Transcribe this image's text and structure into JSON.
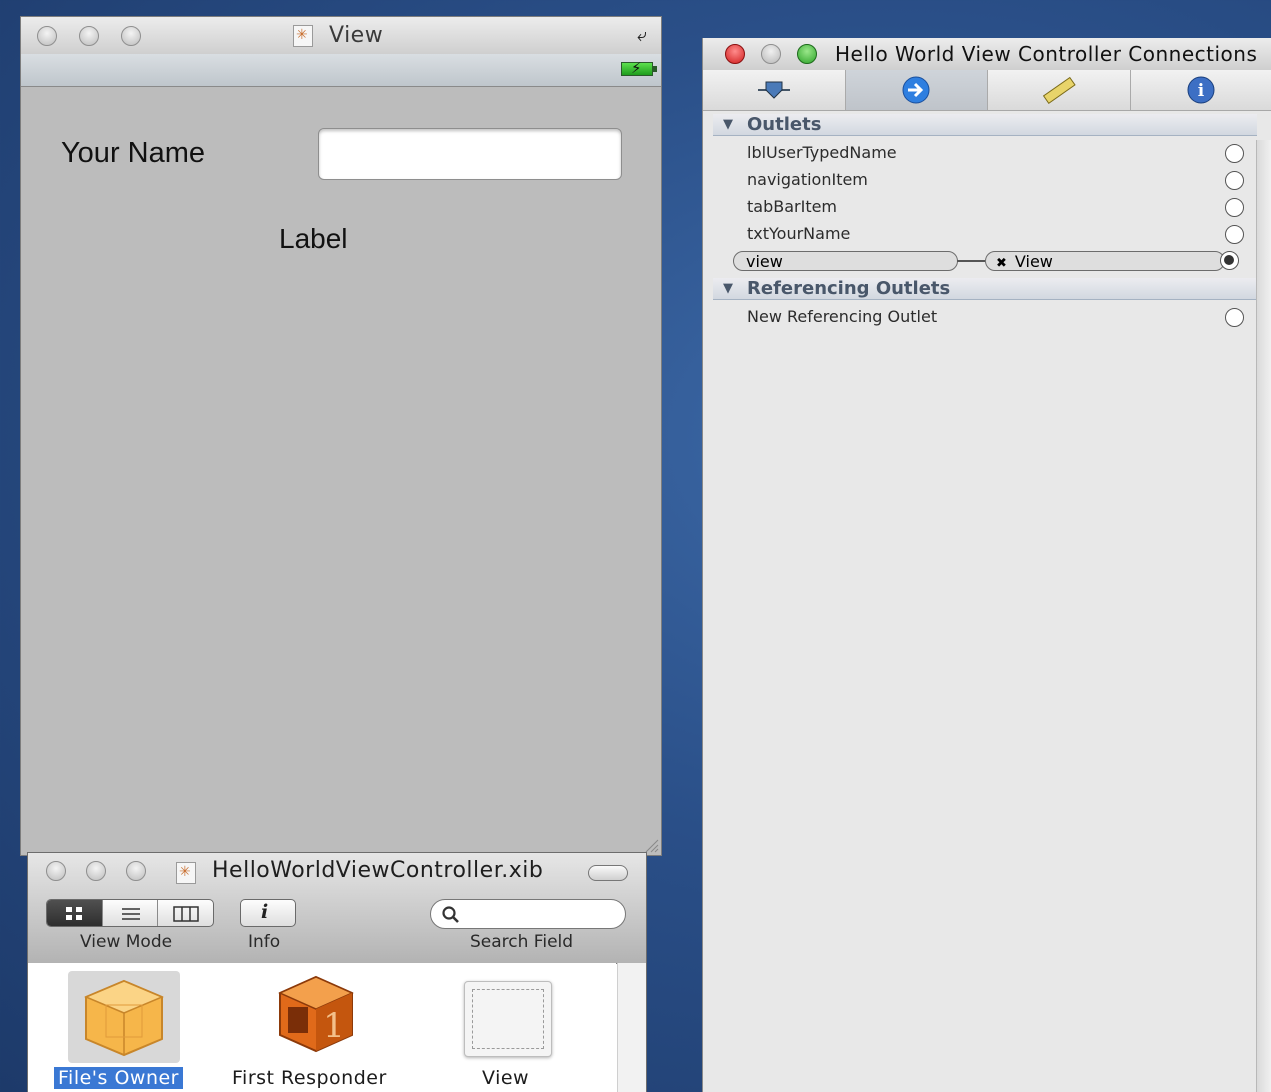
{
  "view_window": {
    "title": "View",
    "name_label": "Your  Name",
    "name_field_value": "",
    "label_text": "Label"
  },
  "connections": {
    "title": "Hello World View Controller Connections",
    "tabs": [
      "attributes-tab",
      "connections-tab",
      "size-tab",
      "identity-tab"
    ],
    "outlets_header": "Outlets",
    "outlets": [
      "lblUserTypedName",
      "navigationItem",
      "tabBarItem",
      "txtYourName"
    ],
    "connected_outlet": {
      "name": "view",
      "target": "View"
    },
    "referencing_header": "Referencing Outlets",
    "referencing": [
      "New Referencing Outlet"
    ]
  },
  "xib_window": {
    "title": "HelloWorldViewController.xib",
    "toolbar": {
      "view_mode_label": "View Mode",
      "info_label": "Info",
      "search_label": "Search Field",
      "search_value": ""
    },
    "objects": [
      {
        "label": "File's Owner",
        "selected": true
      },
      {
        "label": "First Responder",
        "selected": false
      },
      {
        "label": "View",
        "selected": false
      }
    ]
  },
  "colors": {
    "desktop": "#2a4f88",
    "selection": "#3a78d4",
    "first_responder_orange": "#e06a1a"
  }
}
